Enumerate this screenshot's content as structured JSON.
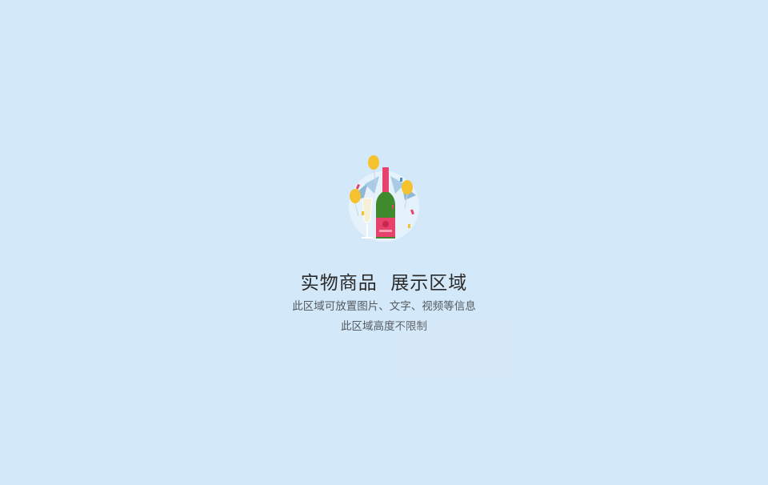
{
  "placeholder": {
    "title": "实物商品  展示区域",
    "line1": "此区域可放置图片、文字、视频等信息",
    "line2": "此区域高度不限制",
    "illustration_icon": "champagne-celebration-icon"
  },
  "colors": {
    "background": "#d3e8f9",
    "bottle_body": "#3f8a2c",
    "bottle_label": "#e8416b",
    "balloon": "#f6c12e",
    "title_text": "#2a2a2a",
    "subtitle_text": "#555a60"
  }
}
